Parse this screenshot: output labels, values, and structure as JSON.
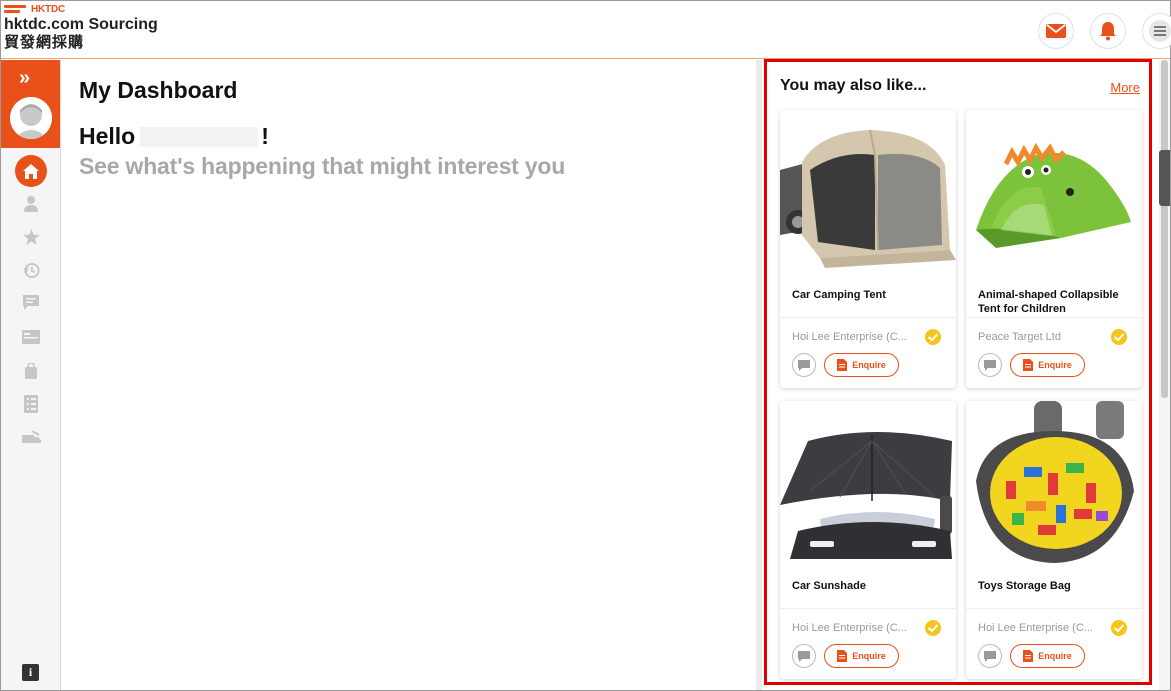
{
  "header": {
    "brand": "HKTDC",
    "site_name": "hktdc.com Sourcing",
    "site_name_zh": "貿發網採購",
    "icons": [
      "mail-icon",
      "bell-icon",
      "menu-icon"
    ],
    "accent": "#e8511a"
  },
  "sidebar": {
    "expand_icon": "»",
    "items": [
      {
        "name": "home-icon",
        "active": true
      },
      {
        "name": "user-icon"
      },
      {
        "name": "star-icon"
      },
      {
        "name": "history-icon"
      },
      {
        "name": "message-icon"
      },
      {
        "name": "card-icon"
      },
      {
        "name": "bag-icon"
      },
      {
        "name": "list-icon"
      },
      {
        "name": "truck-icon"
      }
    ],
    "info_label": "i"
  },
  "main": {
    "title": "My Dashboard",
    "greeting": "Hello",
    "greeting_end": "!",
    "subtitle": "See what's happening that might interest you"
  },
  "recommend": {
    "title": "You may also like...",
    "more_label": "More",
    "enquire_label": "Enquire",
    "products": [
      {
        "name": "Car Camping Tent",
        "supplier": "Hoi Lee Enterprise (C..."
      },
      {
        "name": "Animal-shaped Collapsible Tent for Children",
        "supplier": "Peace Target Ltd"
      },
      {
        "name": "Car Sunshade",
        "supplier": "Hoi Lee Enterprise (C..."
      },
      {
        "name": "Toys Storage Bag",
        "supplier": "Hoi Lee Enterprise (C..."
      }
    ]
  }
}
